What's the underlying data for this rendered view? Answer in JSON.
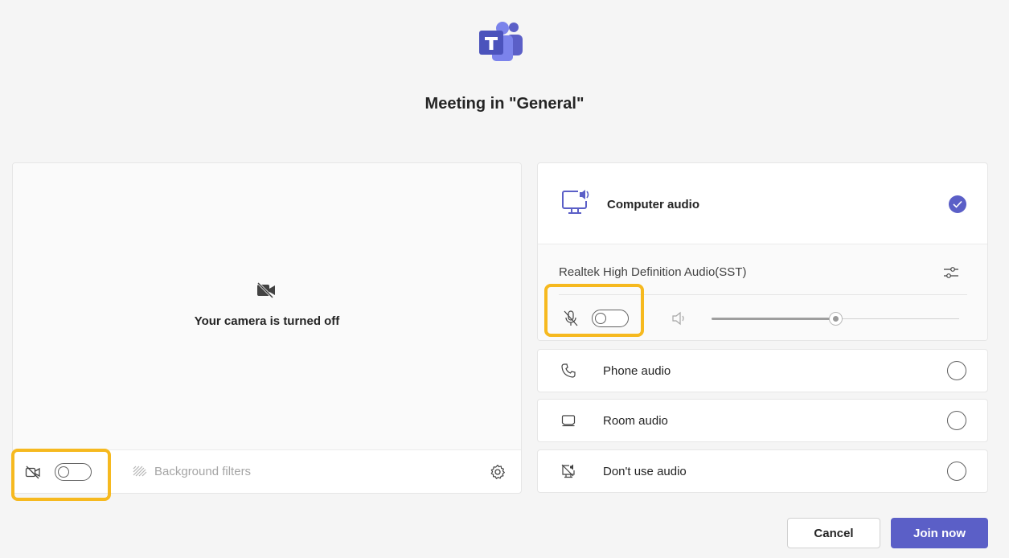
{
  "meeting": {
    "title": "Meeting in \"General\""
  },
  "video": {
    "camera_off_text": "Your camera is turned off",
    "camera_toggle_on": false,
    "background_filters_label": "Background filters"
  },
  "audio": {
    "computer_audio_label": "Computer audio",
    "computer_audio_selected": true,
    "device_name": "Realtek High Definition Audio(SST)",
    "mic_toggle_on": false,
    "volume_percent": 50,
    "options": [
      {
        "label": "Phone audio",
        "icon": "phone-icon",
        "selected": false
      },
      {
        "label": "Room audio",
        "icon": "room-device-icon",
        "selected": false
      },
      {
        "label": "Don't use audio",
        "icon": "no-audio-icon",
        "selected": false
      }
    ]
  },
  "actions": {
    "cancel_label": "Cancel",
    "join_label": "Join now"
  },
  "colors": {
    "accent": "#5b5fc7",
    "highlight": "#f6b91f",
    "background": "#f5f5f5"
  }
}
